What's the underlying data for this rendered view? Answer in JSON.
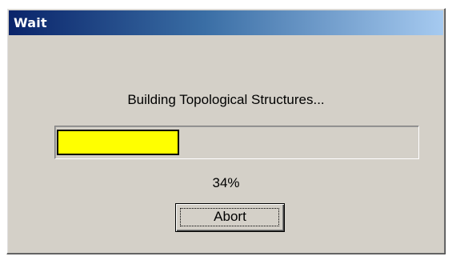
{
  "window": {
    "title": "Wait"
  },
  "dialog": {
    "message": "Building Topological Structures...",
    "progress": {
      "fraction": 0.34,
      "fill_color": "#ffff00"
    },
    "percent_text": "34%",
    "abort_label": "Abort"
  }
}
